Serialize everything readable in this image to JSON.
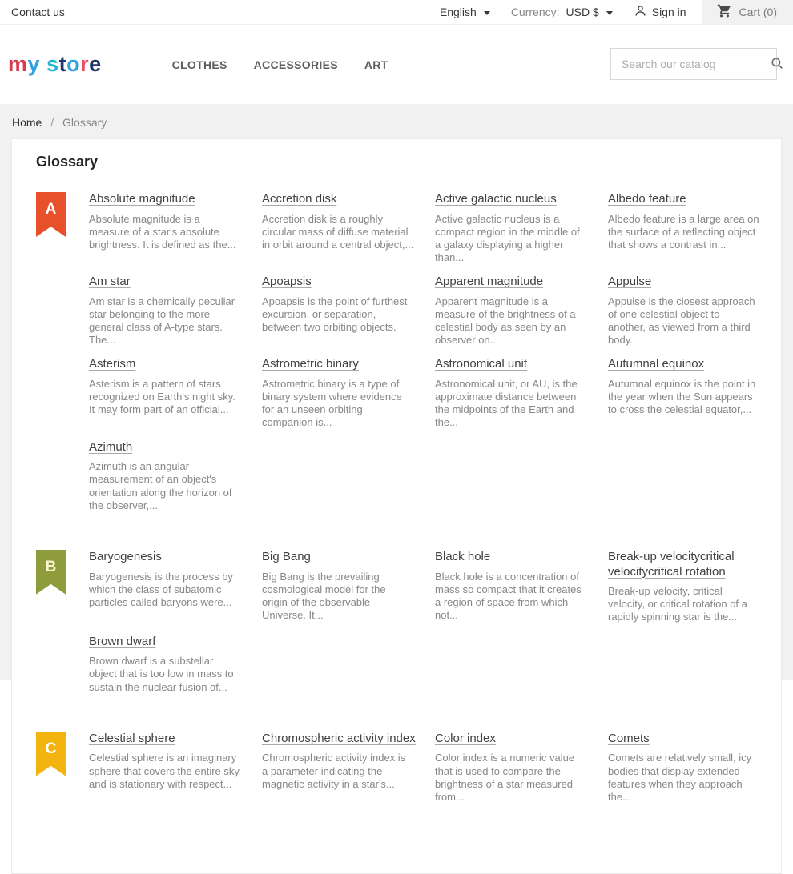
{
  "top_bar": {
    "contact_us": "Contact us",
    "language": {
      "selected": "English"
    },
    "currency": {
      "label": "Currency:",
      "selected": "USD $"
    },
    "sign_in_label": "Sign in",
    "cart_label": "Cart (0)"
  },
  "icons": {
    "language_dropdown": "caret-down-icon",
    "currency_dropdown": "caret-down-icon",
    "sign_in": "person-icon",
    "cart": "shopping-cart-icon",
    "search": "search-icon"
  },
  "header": {
    "logo_text": "my store",
    "logo_letters": [
      {
        "ch": "m",
        "color": "#d63c50"
      },
      {
        "ch": "y",
        "color": "#2e9fe0"
      },
      {
        "ch": " ",
        "color": "#000000"
      },
      {
        "ch": "s",
        "color": "#1fb5cd"
      },
      {
        "ch": "t",
        "color": "#23356d"
      },
      {
        "ch": "o",
        "color": "#2e9fe0"
      },
      {
        "ch": "r",
        "color": "#f04b5f"
      },
      {
        "ch": "e",
        "color": "#23356d"
      }
    ],
    "nav": [
      {
        "label": "CLOTHES"
      },
      {
        "label": "ACCESSORIES"
      },
      {
        "label": "ART"
      }
    ],
    "search_placeholder": "Search our catalog",
    "search_value": ""
  },
  "breadcrumb": {
    "items": [
      "Home",
      "Glossary"
    ],
    "separator": "/"
  },
  "page": {
    "title": "Glossary"
  },
  "glossary": {
    "sections": [
      {
        "letter": "A",
        "color": "#e8502c",
        "letter_color": "#ffffff",
        "terms": [
          {
            "title": "Absolute magnitude",
            "description": "Absolute magnitude is a measure of a star's absolute brightness. It is defined as the..."
          },
          {
            "title": "Accretion disk",
            "description": "Accretion disk is a roughly circular mass of diffuse material in orbit around a central object,..."
          },
          {
            "title": "Active galactic nucleus",
            "description": "Active galactic nucleus is a compact region in the middle of a galaxy displaying a higher than..."
          },
          {
            "title": "Albedo feature",
            "description": "Albedo feature is a large area on the surface of a reflecting object that shows a contrast in..."
          },
          {
            "title": "Am star",
            "description": "Am star is a chemically peculiar star belonging to the more general class of A-type stars. The..."
          },
          {
            "title": "Apoapsis",
            "description": "Apoapsis is the point of furthest excursion, or separation, between two orbiting objects."
          },
          {
            "title": "Apparent magnitude",
            "description": "Apparent magnitude is a measure of the brightness of a celestial body as seen by an observer on..."
          },
          {
            "title": "Appulse",
            "description": "Appulse is the closest approach of one celestial object to another, as viewed from a third body."
          },
          {
            "title": "Asterism",
            "description": "Asterism is a pattern of stars recognized on Earth's night sky. It may form part of an official..."
          },
          {
            "title": "Astrometric binary",
            "description": "Astrometric binary is a type of binary system where evidence for an unseen orbiting companion is..."
          },
          {
            "title": "Astronomical unit",
            "description": "Astronomical unit, or AU, is the approximate distance between the midpoints of the Earth and the..."
          },
          {
            "title": "Autumnal equinox",
            "description": "Autumnal equinox is the point in the year when the Sun appears to cross the celestial equator,..."
          },
          {
            "title": "Azimuth",
            "description": "Azimuth is an angular measurement of an object's orientation along the horizon of the observer,..."
          }
        ]
      },
      {
        "letter": "B",
        "color": "#8e9c3b",
        "letter_color": "#faf5cf",
        "terms": [
          {
            "title": "Baryogenesis",
            "description": "Baryogenesis is the process by which the class of subatomic particles called baryons were..."
          },
          {
            "title": "Big Bang",
            "description": "Big Bang is the prevailing cosmological model for the origin of the observable Universe. It..."
          },
          {
            "title": "Black hole",
            "description": "Black hole is a concentration of mass so compact that it creates a region of space from which not..."
          },
          {
            "title": "Break-up velocitycritical velocitycritical rotation",
            "description": "Break-up velocity, critical velocity, or critical rotation of a rapidly spinning star is the..."
          },
          {
            "title": "Brown dwarf",
            "description": "Brown dwarf is a substellar object that is too low in mass to sustain the nuclear fusion of..."
          }
        ]
      },
      {
        "letter": "C",
        "color": "#f4b40f",
        "letter_color": "#ffffff",
        "terms": [
          {
            "title": "Celestial sphere",
            "description": "Celestial sphere is an imaginary sphere that covers the entire sky and is stationary with respect..."
          },
          {
            "title": "Chromospheric activity index",
            "description": "Chromospheric activity index is a parameter indicating the magnetic activity in a star's..."
          },
          {
            "title": "Color index",
            "description": "Color index is a numeric value that is used to compare the brightness of a star measured from..."
          },
          {
            "title": "Comets",
            "description": "Comets are relatively small, icy bodies that display extended features when they approach the..."
          }
        ]
      }
    ]
  }
}
